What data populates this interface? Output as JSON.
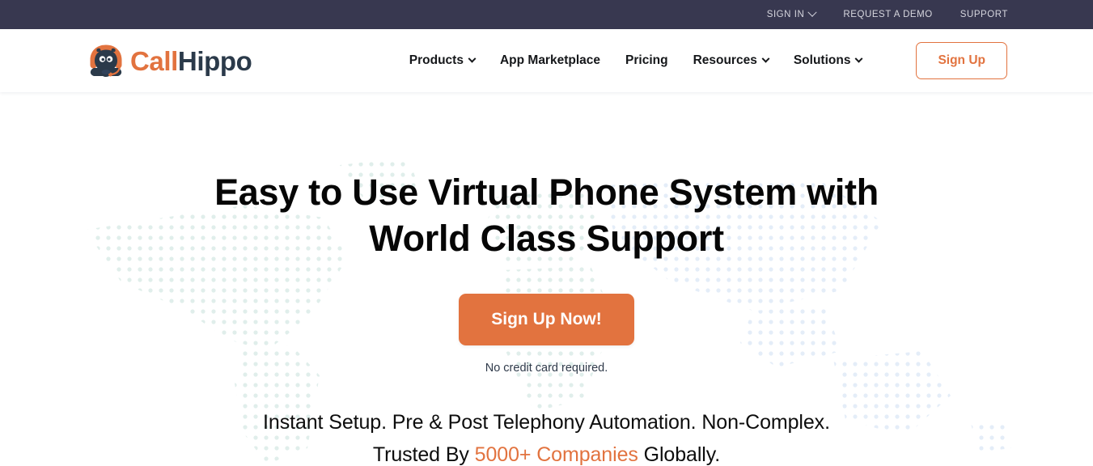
{
  "topbar": {
    "links": [
      {
        "label": "SIGN IN",
        "has_chevron": true,
        "icon": "chevron-down-icon"
      },
      {
        "label": "REQUEST A DEMO",
        "has_chevron": false
      },
      {
        "label": "SUPPORT",
        "has_chevron": false
      }
    ],
    "bg_color": "#383850",
    "text_color": "#d6d6de"
  },
  "header": {
    "logo": {
      "icon": "callhippo-hippo-headset-logo-icon",
      "text_primary": "Call",
      "text_secondary": "Hippo",
      "primary_color": "#e2733f",
      "secondary_color": "#2b3a4a"
    },
    "nav": [
      {
        "label": "Products",
        "has_chevron": true,
        "icon": "chevron-down-icon"
      },
      {
        "label": "App Marketplace",
        "has_chevron": false
      },
      {
        "label": "Pricing",
        "has_chevron": false
      },
      {
        "label": "Resources",
        "has_chevron": true,
        "icon": "chevron-down-icon"
      },
      {
        "label": "Solutions",
        "has_chevron": true,
        "icon": "chevron-down-icon"
      }
    ],
    "signup_label": "Sign Up",
    "accent_color": "#e2733f"
  },
  "hero": {
    "title_line_1": "Easy to Use Virtual Phone System with",
    "title_line_2": "World Class Support",
    "cta_label": "Sign Up Now!",
    "cta_note": "No credit card required.",
    "sub_line_1": "Instant Setup. Pre & Post Telephony Automation. Non-Complex.",
    "sub_line_2_before": "Trusted By ",
    "sub_line_2_highlight": "5000+ Companies",
    "sub_line_2_after": " Globally.",
    "background": "dotted-world-map",
    "dot_color_left": "#dfeeea",
    "dot_color_right": "#e2ecf7",
    "cta_color": "#e2733f"
  }
}
